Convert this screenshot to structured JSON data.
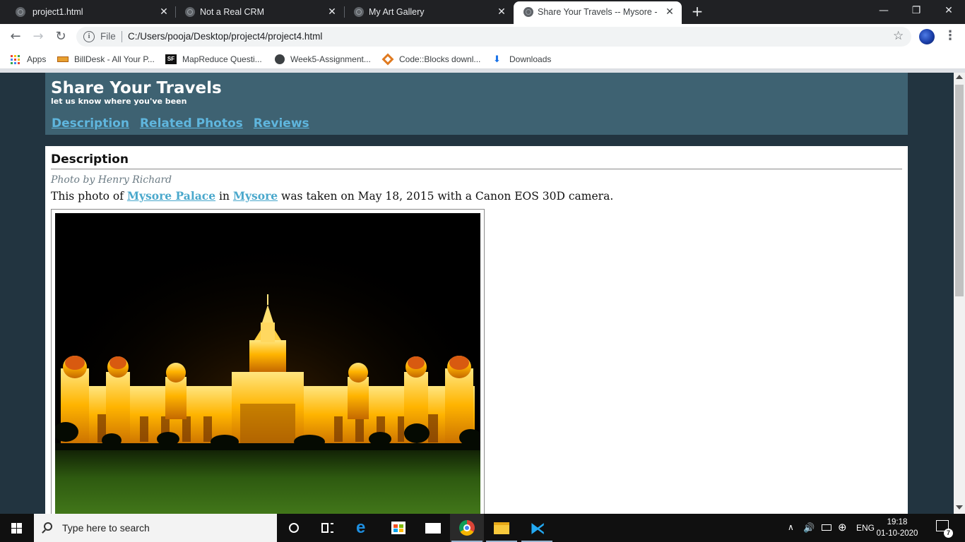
{
  "browser": {
    "tabs": [
      {
        "label": "project1.html",
        "active": false
      },
      {
        "label": "Not a Real CRM",
        "active": false
      },
      {
        "label": "My Art Gallery",
        "active": false
      },
      {
        "label": "Share Your Travels -- Mysore - Cr",
        "active": true
      }
    ],
    "new_tab": "+",
    "window_controls": {
      "minimize": "—",
      "maximize": "❐",
      "close": "✕"
    },
    "omnibox": {
      "scheme_label": "File",
      "url": "C:/Users/pooja/Desktop/project4/project4.html"
    },
    "bookmarks": [
      {
        "label": "Apps",
        "icon": "apps-grid-icon"
      },
      {
        "label": "BillDesk - All Your P...",
        "icon": "billdesk-icon"
      },
      {
        "label": "MapReduce Questi...",
        "icon": "sf-icon"
      },
      {
        "label": "Week5-Assignment...",
        "icon": "globe-icon"
      },
      {
        "label": "Code::Blocks downl...",
        "icon": "codeblocks-icon"
      },
      {
        "label": "Downloads",
        "icon": "download-icon"
      }
    ]
  },
  "page": {
    "header": {
      "title": "Share Your Travels",
      "tagline": "let us know where you've been",
      "nav": [
        "Description",
        "Related Photos",
        "Reviews"
      ]
    },
    "content": {
      "heading": "Description",
      "byline": "Photo by Henry Richard",
      "sentence": {
        "p1": "This photo of ",
        "link1": "Mysore Palace",
        "p2": " in ",
        "link2": "Mysore",
        "p3": " was taken on May 18, 2015 with a Canon EOS 30D camera."
      }
    }
  },
  "taskbar": {
    "search_placeholder": "Type here to search",
    "language": "ENG",
    "time": "19:18",
    "date": "01-10-2020",
    "notification_count": "7"
  },
  "colors": {
    "page_bg": "#223440",
    "header_bg": "#3e6272",
    "nav_link": "#5fb6de",
    "content_link": "#4aa8cc"
  }
}
